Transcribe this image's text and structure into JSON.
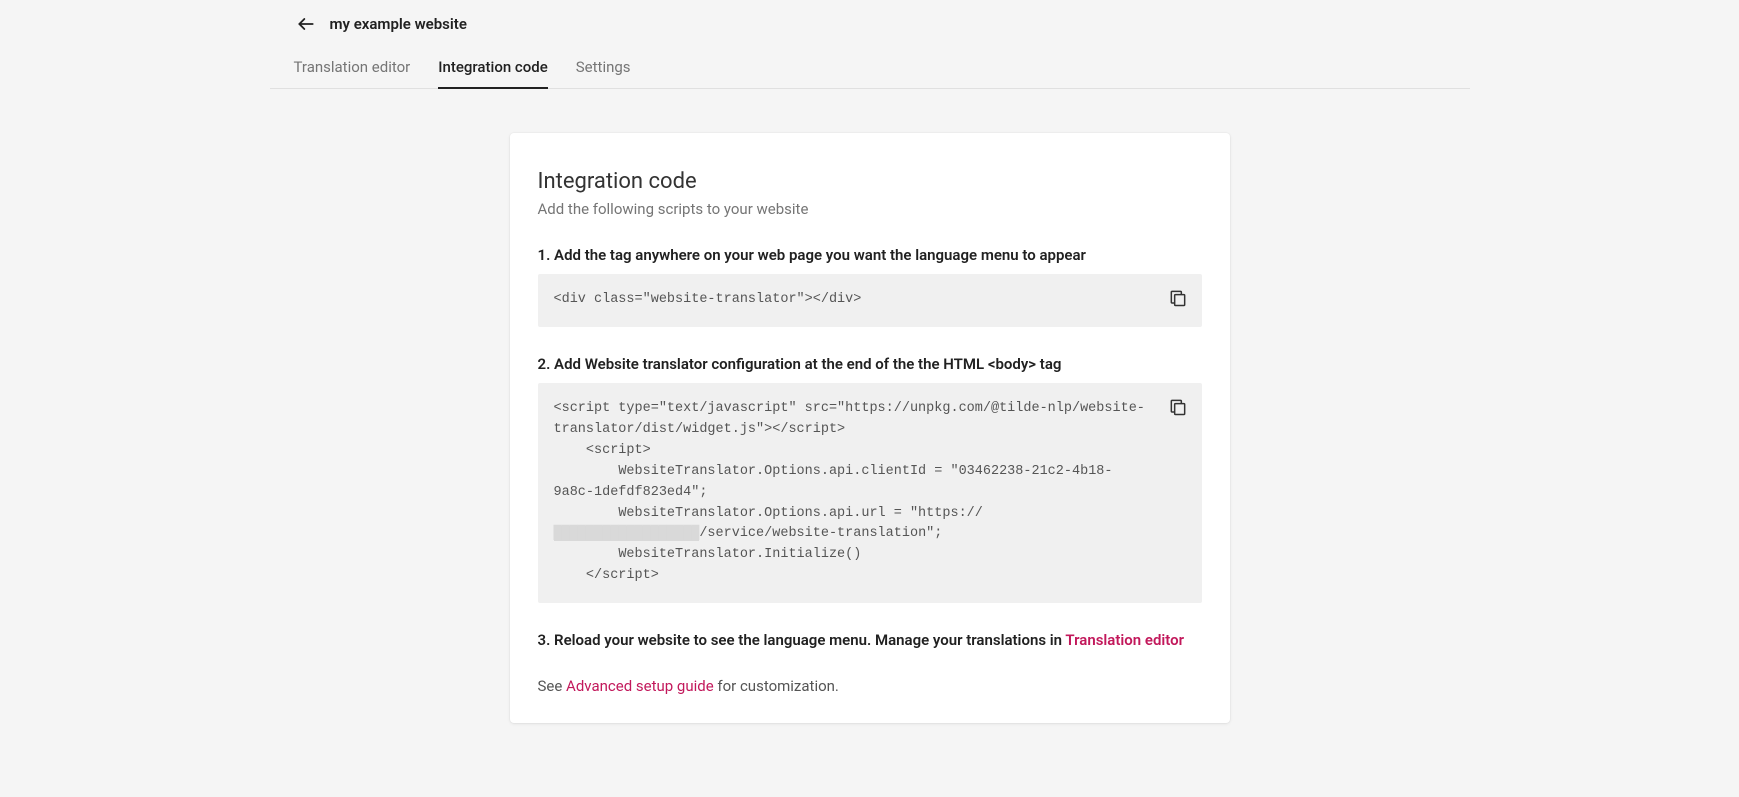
{
  "header": {
    "title": "my example website"
  },
  "tabs": {
    "t0": "Translation editor",
    "t1": "Integration code",
    "t2": "Settings"
  },
  "card": {
    "title": "Integration code",
    "subtitle": "Add the following scripts to your website",
    "step1_label": "1. Add the tag anywhere on your web page you want the language menu to appear",
    "step1_code": "<div class=\"website-translator\"></div>",
    "step2_label": "2. Add Website translator configuration at the end of the the HTML <body> tag",
    "step2_code_pre": "<script type=\"text/javascript\" src=\"https://unpkg.com/@tilde-nlp/website-translator/dist/widget.js\"></script>\n    <script>\n        WebsiteTranslator.Options.api.clientId = \"03462238-21c2-4b18-9a8c-1defdf823ed4\";\n        WebsiteTranslator.Options.api.url = \"https://",
    "step2_code_redact": "██████████████████",
    "step2_code_post": "/service/website-translation\";\n        WebsiteTranslator.Initialize()\n    </script>",
    "step3_prefix": "3. Reload your website to see the language menu. Manage your translations in ",
    "step3_link": "Translation editor",
    "footer_prefix": "See ",
    "footer_link": "Advanced setup guide",
    "footer_suffix": " for customization."
  }
}
